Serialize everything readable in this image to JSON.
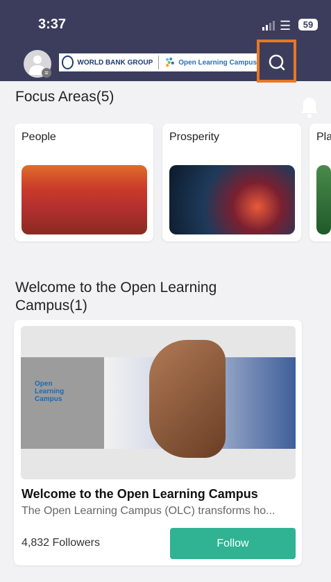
{
  "status_bar": {
    "time": "3:37",
    "battery": "59"
  },
  "header": {
    "logo_wb": "WORLD BANK GROUP",
    "logo_olc": "Open Learning Campus"
  },
  "focus_areas": {
    "title": "Focus Areas(5)",
    "cards": [
      {
        "label": "People"
      },
      {
        "label": "Prosperity"
      },
      {
        "label": "Pla"
      }
    ]
  },
  "welcome": {
    "title": "Welcome to the Open Learning Campus(1)",
    "course": {
      "image_text": "Open Learning Campus",
      "name": "Welcome to the Open Learning Campus",
      "description": "The Open Learning Campus (OLC) transforms ho...",
      "followers": "4,832 Followers",
      "follow_label": "Follow"
    }
  },
  "colors": {
    "header_bg": "#3c3d5c",
    "highlight": "#e87722",
    "follow_btn": "#2fb393"
  }
}
